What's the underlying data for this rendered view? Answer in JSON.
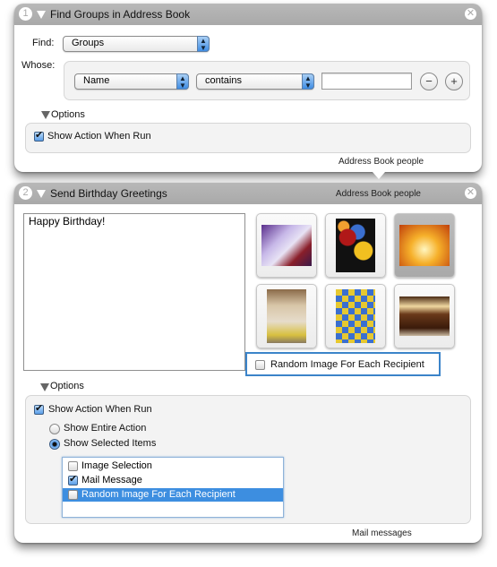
{
  "actions": [
    {
      "number": "1",
      "title": "Find Groups in Address Book",
      "close_icon": "close-circle-icon",
      "find_label": "Find:",
      "find_value": "Groups",
      "whose_label": "Whose:",
      "criteria_field": "Name",
      "criteria_operator": "contains",
      "criteria_value": "",
      "remove_criteria": "−",
      "add_criteria": "+",
      "options_label": "Options",
      "show_action_label": "Show Action When Run",
      "show_action_checked": true,
      "output_label": "Address Book people"
    },
    {
      "number": "2",
      "title": "Send Birthday Greetings",
      "input_label": "Address Book people",
      "close_icon": "close-circle-icon",
      "message_text": "Happy Birthday!",
      "images": [
        {
          "name": "cake-party",
          "selected": false
        },
        {
          "name": "balloons",
          "selected": false
        },
        {
          "name": "candles",
          "selected": true
        },
        {
          "name": "old-man-cake",
          "selected": false
        },
        {
          "name": "kitten-cupcake",
          "selected": false
        },
        {
          "name": "chocolate-cake",
          "selected": false
        }
      ],
      "random_image_label": "Random Image For Each Recipient",
      "random_image_checked": false,
      "options_label": "Options",
      "show_action_label": "Show Action When Run",
      "show_action_checked": true,
      "radio_entire": "Show Entire Action",
      "radio_selected": "Show Selected Items",
      "radio_choice": "Show Selected Items",
      "items": [
        {
          "label": "Image Selection",
          "checked": false,
          "selected": false
        },
        {
          "label": "Mail Message",
          "checked": true,
          "selected": false
        },
        {
          "label": "Random Image For Each Recipient",
          "checked": false,
          "selected": true
        }
      ],
      "output_label": "Mail messages"
    }
  ],
  "colors": {
    "header_gray": "#ababab",
    "selection_blue": "#3d8ee0",
    "focus_blue": "#3b84c9"
  }
}
